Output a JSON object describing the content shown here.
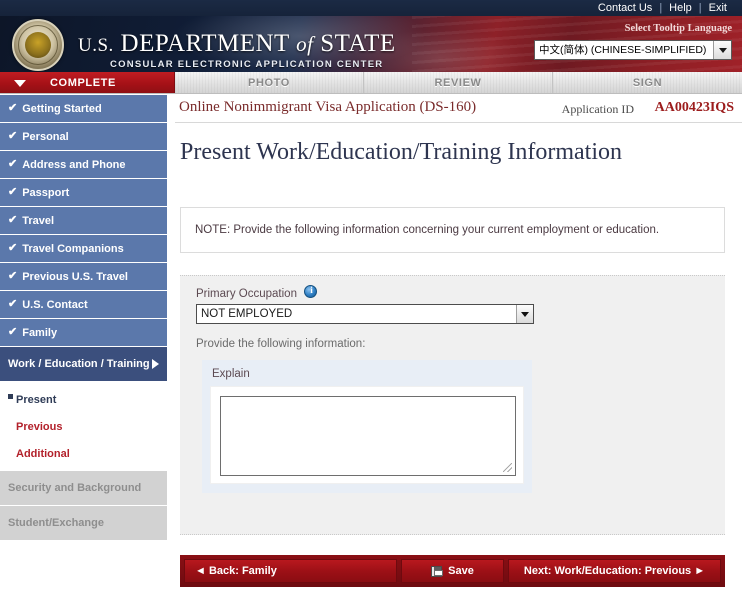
{
  "utility_bar": {
    "links": [
      "Contact Us",
      "Help",
      "Exit"
    ],
    "separator": "|"
  },
  "masthead": {
    "title_us": "U.S.",
    "title_department": "DEPARTMENT",
    "title_of": "of",
    "title_state": "STATE",
    "subtitle": "CONSULAR ELECTRONIC APPLICATION CENTER",
    "tooltip_language_label": "Select Tooltip Language",
    "tooltip_language_value": "中文(简体) (CHINESE-SIMPLIFIED)"
  },
  "tabs": [
    {
      "label": "COMPLETE",
      "active": true
    },
    {
      "label": "PHOTO",
      "active": false
    },
    {
      "label": "REVIEW",
      "active": false
    },
    {
      "label": "SIGN",
      "active": false
    }
  ],
  "app_header": {
    "title": "Online Nonimmigrant Visa Application (DS-160)",
    "application_id_label": "Application ID",
    "application_id_value": "AA00423IQS"
  },
  "sidebar": {
    "completed_items": [
      {
        "label": "Getting Started",
        "check": "✔"
      },
      {
        "label": "Personal",
        "check": "✔"
      },
      {
        "label": "Address and Phone",
        "check": "✔"
      },
      {
        "label": "Passport",
        "check": "✔"
      },
      {
        "label": "Travel",
        "check": "✔"
      },
      {
        "label": "Travel Companions",
        "check": "✔"
      },
      {
        "label": "Previous U.S. Travel",
        "check": "✔"
      },
      {
        "label": "U.S. Contact",
        "check": "✔"
      },
      {
        "label": "Family",
        "check": "✔"
      }
    ],
    "active_group": {
      "label": "Work / Education / Training"
    },
    "sub_items": [
      {
        "label": "Present",
        "state": "current"
      },
      {
        "label": "Previous",
        "state": "link"
      },
      {
        "label": "Additional",
        "state": "link"
      }
    ],
    "disabled_items": [
      {
        "label": "Security and Background"
      },
      {
        "label": "Student/Exchange"
      }
    ]
  },
  "main": {
    "page_title": "Present Work/Education/Training Information",
    "note": "NOTE: Provide the following information concerning your current employment or education.",
    "primary_occupation_label": "Primary Occupation",
    "primary_occupation_value": "NOT EMPLOYED",
    "provide_text": "Provide the following information:",
    "explain_label": "Explain",
    "explain_value": ""
  },
  "footer": {
    "back_label": "◄ Back: Family",
    "save_label": "Save",
    "next_label": "Next: Work/Education: Previous ►"
  },
  "colors": {
    "brand_red": "#9c1016",
    "nav_blue": "#5b78ab",
    "nav_active_blue": "#3b4f7d",
    "link_red": "#b3212b"
  }
}
